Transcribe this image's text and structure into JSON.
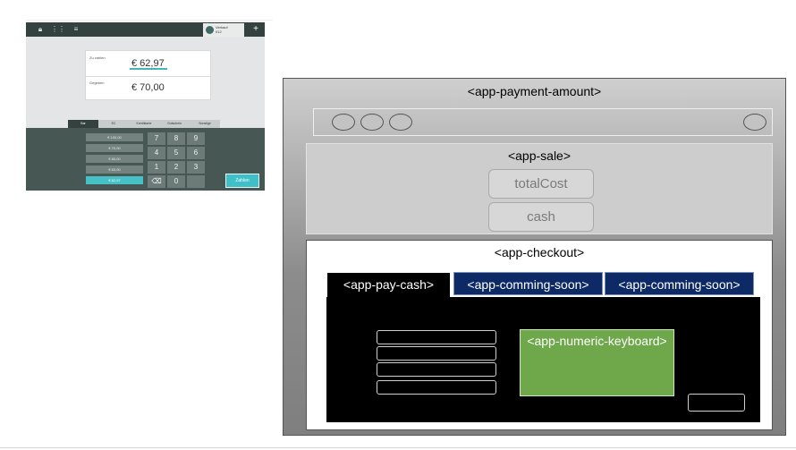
{
  "pos": {
    "topbar": {
      "icons": [
        "lock-icon",
        "grid-icon",
        "list-icon"
      ],
      "user_line1": "Verkauf",
      "user_line2": "012",
      "plus": "+"
    },
    "due_label": "Zu zahlen",
    "due_amount": "€ 62,97",
    "given_label": "Gegeben",
    "given_amount": "€ 70,00",
    "tabs": [
      "Bar",
      "EC",
      "Kreditkarte",
      "Gutschein",
      "Sonstige"
    ],
    "coins": [
      "€ 100,00",
      "€ 70,00",
      "€ 65,00",
      "€ 63,00",
      "€ 62,97"
    ],
    "keys": [
      "7",
      "8",
      "9",
      "4",
      "5",
      "6",
      "1",
      "2",
      "3",
      "",
      "0",
      ""
    ],
    "pay_button": "Zahlen"
  },
  "diagram": {
    "root_label": "<app-payment-amount>",
    "sale_label": "<app-sale>",
    "total_cost": "totalCost",
    "cash": "cash",
    "checkout_label": "<app-checkout>",
    "tab_pay_cash": "<app-pay-cash>",
    "tab_soon_1": "<app-comming-soon>",
    "tab_soon_2": "<app-comming-soon>",
    "keyboard_label": "<app-numeric-keyboard>"
  }
}
